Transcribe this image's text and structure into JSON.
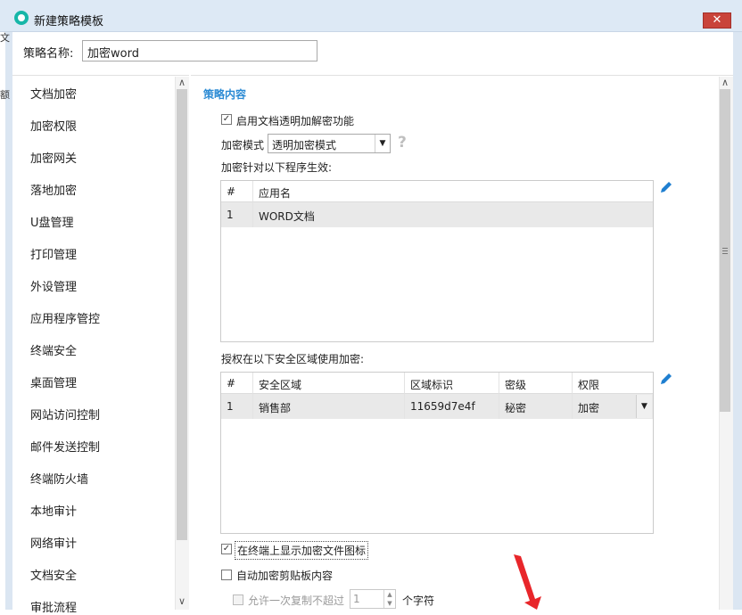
{
  "window": {
    "title": "新建策略模板",
    "close_label": "✕",
    "bg_glyph_1": "文",
    "bg_glyph_2": "额"
  },
  "name_field": {
    "label": "策略名称:",
    "value": "加密word"
  },
  "sidebar": {
    "items": [
      {
        "label": "文档加密"
      },
      {
        "label": "加密权限"
      },
      {
        "label": "加密网关"
      },
      {
        "label": "落地加密"
      },
      {
        "label": "U盘管理"
      },
      {
        "label": "打印管理"
      },
      {
        "label": "外设管理"
      },
      {
        "label": "应用程序管控"
      },
      {
        "label": "终端安全"
      },
      {
        "label": "桌面管理"
      },
      {
        "label": "网站访问控制"
      },
      {
        "label": "邮件发送控制"
      },
      {
        "label": "终端防火墙"
      },
      {
        "label": "本地审计"
      },
      {
        "label": "网络审计"
      },
      {
        "label": "文档安全"
      },
      {
        "label": "审批流程"
      }
    ],
    "scroll_up": "∧",
    "scroll_down": "∨"
  },
  "content": {
    "section_title": "策略内容",
    "enable_transparent": {
      "label": "启用文档透明加解密功能",
      "checked": true
    },
    "encrypt_mode": {
      "label": "加密模式",
      "value": "透明加密模式"
    },
    "help_icon": "?",
    "programs_label": "加密针对以下程序生效:",
    "programs_table": {
      "headers": [
        "#",
        "应用名"
      ],
      "rows": [
        [
          "1",
          "WORD文档"
        ]
      ]
    },
    "zones_label": "授权在以下安全区域使用加密:",
    "zones_table": {
      "headers": [
        "#",
        "安全区域",
        "区域标识",
        "密级",
        "权限"
      ],
      "rows": [
        [
          "1",
          "销售部",
          "11659d7e4f",
          "秘密",
          "加密"
        ]
      ]
    },
    "show_icon": {
      "label": "在终端上显示加密文件图标",
      "checked": true
    },
    "auto_clipboard": {
      "label": "自动加密剪贴板内容",
      "checked": false
    },
    "allow_copy": {
      "label": "允许一次复制不超过",
      "value": "1",
      "suffix": "个字符",
      "checked": false
    }
  },
  "colors": {
    "accent": "#2a8ad4",
    "close": "#c9443a",
    "titlebar": "#dde9f5",
    "arrow": "#e8262a"
  },
  "icons": [
    "app-icon",
    "close-icon",
    "edit-icon",
    "help-icon",
    "dropdown-icon",
    "scroll-arrow-icon"
  ]
}
